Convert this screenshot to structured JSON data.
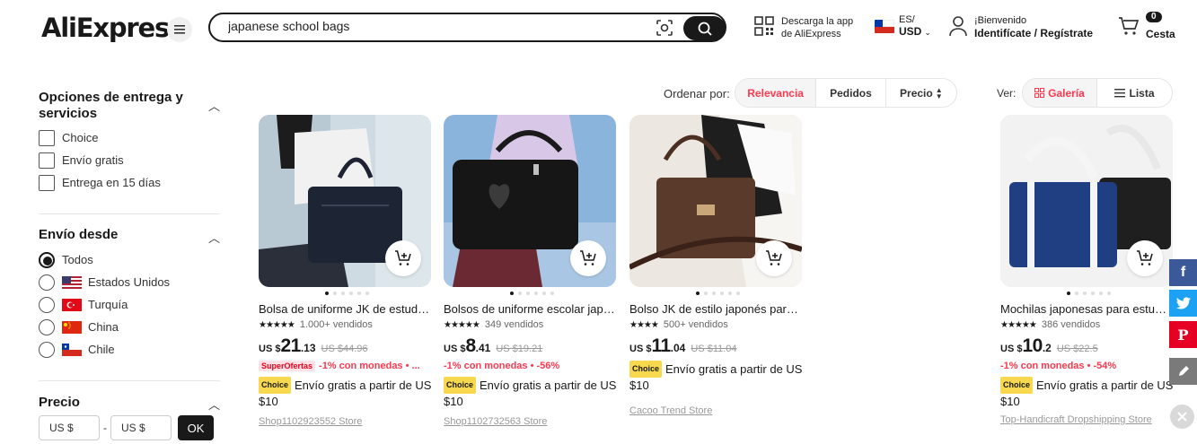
{
  "header": {
    "logo": "AliExpress",
    "search_value": "japanese school bags",
    "app_line1": "Descarga la app",
    "app_line2": "de AliExpress",
    "lang": "ES/",
    "currency": "USD",
    "welcome": "¡Bienvenido",
    "signin": "Identifícate / Regístrate",
    "cart_count": "0",
    "cart_label": "Cesta"
  },
  "sidebar": {
    "delivery_title": "Opciones de entrega y servicios",
    "delivery_options": [
      "Choice",
      "Envío gratis",
      "Entrega en 15 días"
    ],
    "ship_from_title": "Envío desde",
    "ship_from": [
      {
        "label": "Todos",
        "selected": true
      },
      {
        "label": "Estados Unidos",
        "selected": false
      },
      {
        "label": "Turquía",
        "selected": false
      },
      {
        "label": "China",
        "selected": false
      },
      {
        "label": "Chile",
        "selected": false
      }
    ],
    "price_title": "Precio",
    "price_min": "US $",
    "price_sep": "-",
    "price_max": "US $",
    "ok": "OK"
  },
  "sort": {
    "label": "Ordenar por:",
    "options": [
      "Relevancia",
      "Pedidos",
      "Precio"
    ],
    "active": "Relevancia"
  },
  "view": {
    "label": "Ver:",
    "gallery": "Galería",
    "list": "Lista",
    "active": "Galería"
  },
  "products": [
    {
      "title": "Bolsa de uniforme JK de estudiante japonesa",
      "stars": "★★★★★",
      "sold": "1.000+ vendidos",
      "cur": "US $",
      "price_int": "21",
      "price_dec": ".13",
      "old_price": "US $44.96",
      "super": "SuperOfertas",
      "promo": "-1% con monedas • ...",
      "choice": "Choice",
      "shipping": "Envío gratis a partir de US $10",
      "store": "Shop1102923552 Store"
    },
    {
      "title": "Bolsos de uniforme escolar japonés",
      "stars": "★★★★★",
      "sold": "349 vendidos",
      "cur": "US $",
      "price_int": "8",
      "price_dec": ".41",
      "old_price": "US $19.21",
      "super": "",
      "promo": "-1% con monedas • -56%",
      "choice": "Choice",
      "shipping": "Envío gratis a partir de US $10",
      "store": "Shop1102732563 Store"
    },
    {
      "title": "Bolso JK de estilo japonés para mujer",
      "stars": "★★★★",
      "sold": "500+ vendidos",
      "cur": "US $",
      "price_int": "11",
      "price_dec": ".04",
      "old_price": "US $11.04",
      "super": "",
      "promo": "",
      "choice": "Choice",
      "shipping": "Envío gratis a partir de US $10",
      "store": "Cacoo Trend Store"
    },
    {
      "title": "Mochilas japonesas para estudiantes",
      "stars": "★★★★★",
      "sold": "386 vendidos",
      "cur": "US $",
      "price_int": "10",
      "price_dec": ".2",
      "old_price": "US $22.5",
      "super": "",
      "promo": "-1% con monedas • -54%",
      "choice": "Choice",
      "shipping": "Envío gratis a partir de US $10",
      "store": "Top-Handicraft Dropshipping Store"
    }
  ],
  "colors": {
    "accent": "#fd384f",
    "dark": "#191919",
    "choice": "#f7d84e",
    "facebook": "#3b5998",
    "twitter": "#1da1f2",
    "pinterest": "#e60023",
    "edit": "#7a7a7a"
  }
}
